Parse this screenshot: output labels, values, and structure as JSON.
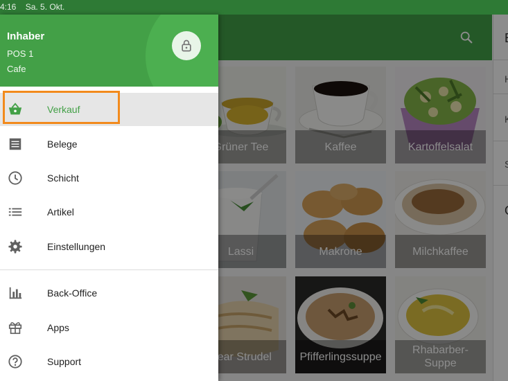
{
  "status_bar": {
    "time": "4:16",
    "date": "Sa. 5. Okt."
  },
  "drawer": {
    "user": "Inhaber",
    "pos": "POS 1",
    "store": "Cafe",
    "items": [
      {
        "label": "Verkauf",
        "icon": "basket-icon"
      },
      {
        "label": "Belege",
        "icon": "receipt-icon"
      },
      {
        "label": "Schicht",
        "icon": "clock-icon"
      },
      {
        "label": "Artikel",
        "icon": "list-icon"
      },
      {
        "label": "Einstellungen",
        "icon": "gear-icon"
      },
      {
        "label": "Back-Office",
        "icon": "bar-chart-icon"
      },
      {
        "label": "Apps",
        "icon": "gift-icon"
      },
      {
        "label": "Support",
        "icon": "help-circle-icon"
      }
    ]
  },
  "products": [
    {
      "name": "Grüner Tee"
    },
    {
      "name": "Kaffee"
    },
    {
      "name": "Kartoffelsalat"
    },
    {
      "name": "Lassi"
    },
    {
      "name": "Makrone"
    },
    {
      "name": "Milchkaffee"
    },
    {
      "name": "Pear Strudel"
    },
    {
      "name": "Pfifferlingssuppe"
    },
    {
      "name": "Rhabarber-Suppe"
    }
  ],
  "right_panel_letters": [
    "E",
    "H",
    "K",
    "S",
    "O"
  ],
  "colors": {
    "primary": "#43a047",
    "status": "#2e7a35",
    "highlight": "#f28a1c"
  }
}
